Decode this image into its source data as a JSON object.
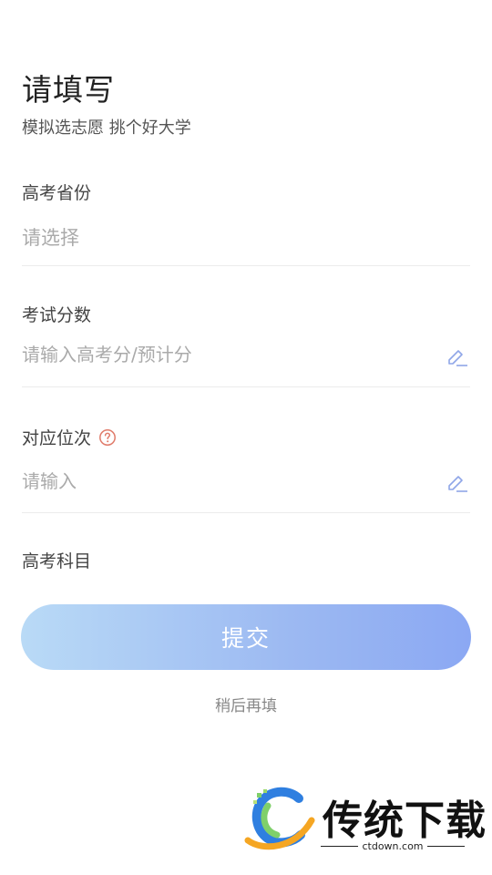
{
  "header": {
    "title": "请填写",
    "subtitle": "模拟选志愿 挑个好大学"
  },
  "form": {
    "province": {
      "label": "高考省份",
      "value": "请选择"
    },
    "score": {
      "label": "考试分数",
      "placeholder": "请输入高考分/预计分"
    },
    "rank": {
      "label": "对应位次",
      "placeholder": "请输入"
    },
    "subjects": {
      "label": "高考科目"
    }
  },
  "actions": {
    "submit_label": "提交",
    "later_label": "稍后再填"
  },
  "watermark": {
    "text": "传统下载",
    "url": "ctdown.com"
  },
  "colors": {
    "accent_start": "#b9daf6",
    "accent_end": "#8ba8f3",
    "help_icon": "#e07b6a",
    "edit_icon": "#8fa6e8"
  }
}
